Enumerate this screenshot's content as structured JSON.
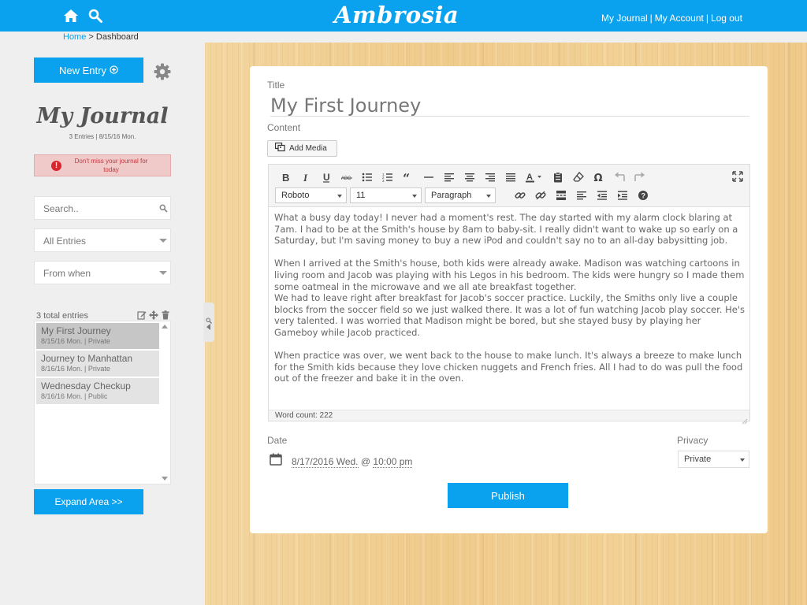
{
  "header": {
    "brand": "Ambrosia",
    "nav": [
      "My Journal",
      "My Account",
      "Log out"
    ],
    "separator": "|",
    "icons": [
      "home-icon",
      "search-icon"
    ]
  },
  "breadcrumb": {
    "home": "Home",
    "separator": ">",
    "current": "Dashboard"
  },
  "sidebar": {
    "new_entry_label": "New Entry",
    "journal_title": "My Journal",
    "journal_meta": "3 Entries | 8/15/16 Mon.",
    "alert_text": "Don't miss your journal for today",
    "search_placeholder": "Search..",
    "filter_value": "All Entries",
    "when_value": "From when",
    "entries_count_label": "3 total entries",
    "entries": [
      {
        "title": "My First Journey",
        "meta": "8/15/16 Mon. | Private"
      },
      {
        "title": "Journey to Manhattan",
        "meta": "8/16/16 Mon. | Private"
      },
      {
        "title": "Wednesday Checkup",
        "meta": "8/16/16 Mon. | Public"
      }
    ],
    "expand_label": "Expand Area >>"
  },
  "editor": {
    "title_label": "Title",
    "title_value": "My First Journey",
    "content_label": "Content",
    "add_media_label": "Add Media",
    "font_family": "Roboto",
    "font_size": "11",
    "block_format": "Paragraph",
    "paragraphs": [
      "What a busy day today!  I never had a moment's rest.  The day started with my alarm clock blaring at 7am.  I had to be at the Smith's house by 8am to baby-sit. I really didn't want to wake up so early on a Saturday, but I'm saving money to buy a new iPod and couldn't say no to an all-day babysitting job.",
      "When I arrived at the Smith's house, both kids were already awake.  Madison was watching cartoons in living room and Jacob was playing with his Legos in his bedroom.   The kids were hungry so I made them some oatmeal in the microwave and we all ate breakfast together.",
      "We had to leave right after breakfast for Jacob's soccer practice.  Luckily, the Smiths only live a couple blocks from the soccer field so we just walked there.  It was a lot of fun watching Jacob play soccer.  He's very talented.  I was worried that Madison might be bored, but she stayed busy by playing her Gameboy while Jacob practiced.",
      "When practice was over, we went back to the house to make lunch.  It's always a breeze to make lunch for the Smith kids because they love chicken nuggets and French fries.  All I had to do was pull the food out of the freezer and bake it in the oven."
    ],
    "word_count_label": "Word count:",
    "word_count": "222",
    "date_label": "Date",
    "date_value": "8/17/2016 Wed.",
    "date_at": "@",
    "time_value": "10:00 pm",
    "privacy_label": "Privacy",
    "privacy_value": "Private",
    "publish_label": "Publish"
  },
  "colors": {
    "accent": "#0aa2ee",
    "alert_bg": "#f0c9c9",
    "alert_text": "#c0393e",
    "wood": "#f1cf94"
  }
}
